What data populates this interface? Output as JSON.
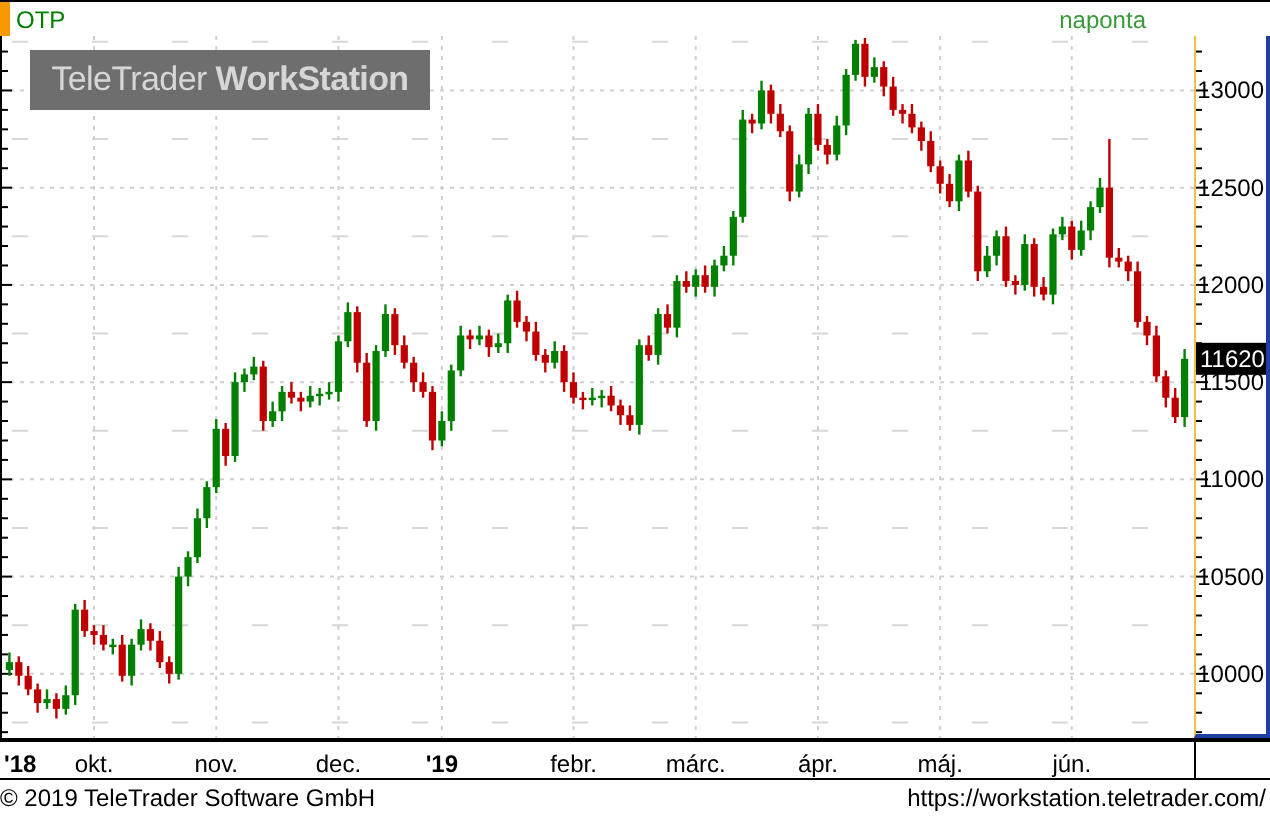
{
  "header": {
    "symbol": "OTP",
    "interval": "naponta"
  },
  "logo": "TeleTrader **WorkStation**",
  "chart": {
    "chart_data": {
      "type": "candlestick",
      "grid": true,
      "categories": [
        "'18",
        null,
        null,
        null,
        null,
        null,
        null,
        null,
        null,
        "okt.",
        null,
        null,
        null,
        null,
        null,
        null,
        null,
        null,
        null,
        null,
        null,
        null,
        "nov.",
        null,
        null,
        null,
        null,
        null,
        null,
        null,
        null,
        null,
        null,
        null,
        null,
        "dec.",
        null,
        null,
        null,
        null,
        null,
        null,
        null,
        null,
        null,
        null,
        "'19",
        null,
        null,
        null,
        null,
        null,
        null,
        null,
        null,
        null,
        null,
        null,
        null,
        null,
        "febr.",
        null,
        null,
        null,
        null,
        null,
        null,
        null,
        null,
        null,
        null,
        null,
        null,
        "márc.",
        null,
        null,
        null,
        null,
        null,
        null,
        null,
        null,
        null,
        null,
        null,
        null,
        "ápr.",
        null,
        null,
        null,
        null,
        null,
        null,
        null,
        null,
        null,
        null,
        null,
        null,
        "máj.",
        null,
        null,
        null,
        null,
        null,
        null,
        null,
        null,
        null,
        null,
        null,
        null,
        null,
        "jún.",
        null,
        null,
        null,
        null,
        null,
        null,
        null,
        null,
        null,
        null,
        null,
        null
      ],
      "ohlc": [
        [
          10020,
          10110,
          9990,
          10060
        ],
        [
          10060,
          10090,
          9940,
          9990
        ],
        [
          9990,
          10040,
          9890,
          9920
        ],
        [
          9920,
          9950,
          9800,
          9850
        ],
        [
          9850,
          9920,
          9820,
          9870
        ],
        [
          9870,
          9900,
          9770,
          9820
        ],
        [
          9820,
          9940,
          9790,
          9890
        ],
        [
          9890,
          10360,
          9840,
          10330
        ],
        [
          10330,
          10380,
          10190,
          10220
        ],
        [
          10220,
          10250,
          10150,
          10200
        ],
        [
          10200,
          10250,
          10120,
          10150
        ],
        [
          10150,
          10180,
          10100,
          10150
        ],
        [
          10150,
          10200,
          9960,
          9990
        ],
        [
          9990,
          10180,
          9940,
          10150
        ],
        [
          10150,
          10280,
          10120,
          10230
        ],
        [
          10230,
          10260,
          10120,
          10170
        ],
        [
          10170,
          10220,
          10030,
          10060
        ],
        [
          10060,
          10090,
          9950,
          10000
        ],
        [
          10000,
          10550,
          9970,
          10500
        ],
        [
          10500,
          10630,
          10450,
          10600
        ],
        [
          10600,
          10850,
          10570,
          10800
        ],
        [
          10800,
          10990,
          10750,
          10960
        ],
        [
          10960,
          11310,
          10930,
          11260
        ],
        [
          11260,
          11290,
          11070,
          11120
        ],
        [
          11120,
          11550,
          11090,
          11500
        ],
        [
          11500,
          11570,
          11450,
          11540
        ],
        [
          11540,
          11630,
          11510,
          11580
        ],
        [
          11580,
          11610,
          11250,
          11300
        ],
        [
          11300,
          11400,
          11270,
          11350
        ],
        [
          11350,
          11480,
          11300,
          11450
        ],
        [
          11450,
          11500,
          11390,
          11420
        ],
        [
          11420,
          11450,
          11350,
          11400
        ],
        [
          11400,
          11480,
          11370,
          11430
        ],
        [
          11430,
          11470,
          11380,
          11440
        ],
        [
          11440,
          11500,
          11410,
          11450
        ],
        [
          11450,
          11740,
          11400,
          11710
        ],
        [
          11710,
          11910,
          11680,
          11860
        ],
        [
          11860,
          11890,
          11550,
          11600
        ],
        [
          11600,
          11650,
          11270,
          11300
        ],
        [
          11300,
          11690,
          11250,
          11660
        ],
        [
          11660,
          11900,
          11630,
          11850
        ],
        [
          11850,
          11880,
          11640,
          11690
        ],
        [
          11690,
          11740,
          11570,
          11600
        ],
        [
          11600,
          11630,
          11450,
          11500
        ],
        [
          11500,
          11550,
          11420,
          11450
        ],
        [
          11450,
          11480,
          11150,
          11200
        ],
        [
          11200,
          11350,
          11170,
          11300
        ],
        [
          11300,
          11590,
          11250,
          11560
        ],
        [
          11560,
          11790,
          11530,
          11740
        ],
        [
          11740,
          11770,
          11670,
          11720
        ],
        [
          11720,
          11790,
          11690,
          11740
        ],
        [
          11740,
          11770,
          11630,
          11680
        ],
        [
          11680,
          11750,
          11650,
          11700
        ],
        [
          11700,
          11950,
          11650,
          11920
        ],
        [
          11920,
          11970,
          11780,
          11810
        ],
        [
          11810,
          11840,
          11710,
          11760
        ],
        [
          11760,
          11810,
          11610,
          11640
        ],
        [
          11640,
          11670,
          11550,
          11600
        ],
        [
          11600,
          11710,
          11570,
          11660
        ],
        [
          11660,
          11690,
          11450,
          11500
        ],
        [
          11500,
          11550,
          11390,
          11420
        ],
        [
          11420,
          11450,
          11360,
          11410
        ],
        [
          11410,
          11470,
          11380,
          11420
        ],
        [
          11420,
          11460,
          11370,
          11430
        ],
        [
          11430,
          11480,
          11350,
          11380
        ],
        [
          11380,
          11410,
          11280,
          11330
        ],
        [
          11330,
          11380,
          11250,
          11280
        ],
        [
          11280,
          11720,
          11230,
          11690
        ],
        [
          11690,
          11740,
          11610,
          11640
        ],
        [
          11640,
          11880,
          11590,
          11850
        ],
        [
          11850,
          11900,
          11750,
          11780
        ],
        [
          11780,
          12050,
          11730,
          12020
        ],
        [
          12020,
          12070,
          11960,
          11990
        ],
        [
          11990,
          12080,
          11940,
          12050
        ],
        [
          12050,
          12100,
          11960,
          11990
        ],
        [
          11990,
          12130,
          11940,
          12100
        ],
        [
          12100,
          12200,
          12070,
          12150
        ],
        [
          12150,
          12380,
          12100,
          12350
        ],
        [
          12350,
          12900,
          12320,
          12850
        ],
        [
          12850,
          12880,
          12780,
          12830
        ],
        [
          12830,
          13050,
          12800,
          13000
        ],
        [
          13000,
          13030,
          12830,
          12880
        ],
        [
          12880,
          12930,
          12760,
          12790
        ],
        [
          12790,
          12820,
          12430,
          12480
        ],
        [
          12480,
          12670,
          12450,
          12620
        ],
        [
          12620,
          12910,
          12570,
          12880
        ],
        [
          12880,
          12930,
          12690,
          12720
        ],
        [
          12720,
          12750,
          12620,
          12670
        ],
        [
          12670,
          12870,
          12640,
          12820
        ],
        [
          12820,
          13110,
          12770,
          13080
        ],
        [
          13080,
          13260,
          13050,
          13240
        ],
        [
          13240,
          13270,
          13020,
          13070
        ],
        [
          13070,
          13170,
          13040,
          13120
        ],
        [
          13120,
          13150,
          12970,
          13020
        ],
        [
          13020,
          13070,
          12870,
          12900
        ],
        [
          12900,
          12930,
          12830,
          12880
        ],
        [
          12880,
          12930,
          12780,
          12810
        ],
        [
          12810,
          12840,
          12690,
          12740
        ],
        [
          12740,
          12790,
          12580,
          12610
        ],
        [
          12610,
          12640,
          12470,
          12520
        ],
        [
          12520,
          12570,
          12400,
          12430
        ],
        [
          12430,
          12670,
          12380,
          12640
        ],
        [
          12640,
          12690,
          12450,
          12480
        ],
        [
          12480,
          12510,
          12020,
          12070
        ],
        [
          12070,
          12200,
          12040,
          12150
        ],
        [
          12150,
          12280,
          12100,
          12250
        ],
        [
          12250,
          12300,
          11990,
          12020
        ],
        [
          12020,
          12050,
          11950,
          12000
        ],
        [
          12000,
          12260,
          11970,
          12210
        ],
        [
          12210,
          12240,
          11940,
          11990
        ],
        [
          11990,
          12040,
          11920,
          11950
        ],
        [
          11950,
          12290,
          11900,
          12260
        ],
        [
          12260,
          12350,
          12230,
          12300
        ],
        [
          12300,
          12330,
          12130,
          12180
        ],
        [
          12180,
          12330,
          12150,
          12280
        ],
        [
          12280,
          12430,
          12230,
          12400
        ],
        [
          12400,
          12550,
          12370,
          12500
        ],
        [
          12500,
          12750,
          12090,
          12140
        ],
        [
          12140,
          12190,
          12090,
          12120
        ],
        [
          12120,
          12150,
          12020,
          12070
        ],
        [
          12070,
          12120,
          11780,
          11810
        ],
        [
          11810,
          11840,
          11690,
          11740
        ],
        [
          11740,
          11790,
          11500,
          11530
        ],
        [
          11530,
          11560,
          11370,
          11420
        ],
        [
          11420,
          11470,
          11290,
          11320
        ],
        [
          11320,
          11670,
          11270,
          11620
        ]
      ],
      "ylim": [
        9670,
        13280
      ],
      "yticks": [
        10000,
        10500,
        11000,
        11500,
        12000,
        12500,
        13000
      ]
    },
    "bold_ticks": [
      true,
      false,
      false,
      false,
      true,
      false,
      false,
      false,
      false,
      false
    ],
    "last_price": "11620"
  },
  "footer": {
    "copyright": "© 2019 TeleTrader Software GmbH",
    "url": "https://workstation.teletrader.com/"
  }
}
